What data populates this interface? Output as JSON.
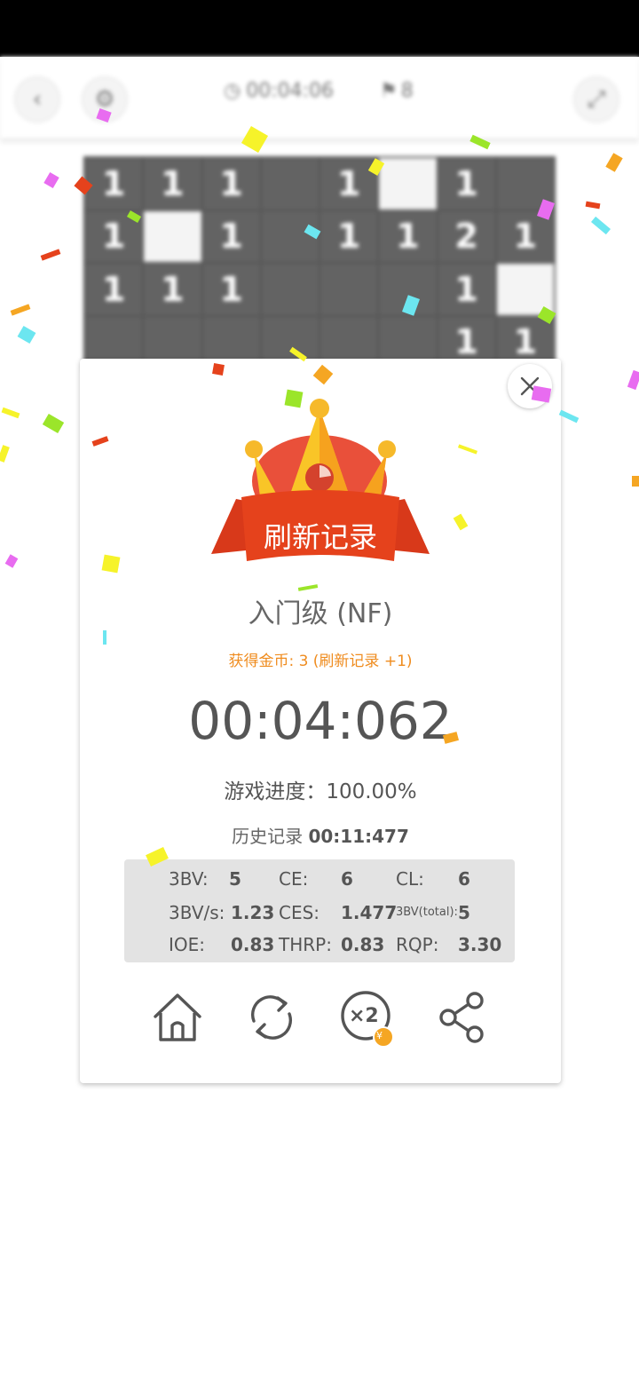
{
  "game": {
    "timer": "00:04:06",
    "flags": "8",
    "board_rows": [
      [
        "1",
        "1",
        "1",
        "",
        "1",
        "open",
        "1",
        ""
      ],
      [
        "1",
        "open",
        "1",
        "",
        "1",
        "1",
        "2",
        "1"
      ],
      [
        "1",
        "1",
        "1",
        "",
        "",
        "",
        "1",
        "open"
      ],
      [
        "",
        "",
        "",
        "",
        "",
        "",
        "1",
        "1"
      ]
    ]
  },
  "dialog": {
    "banner": "刷新记录",
    "level": "入门级 (NF)",
    "coins": "获得金币: 3 (刷新记录 +1)",
    "time": "00:04:062",
    "progress": "游戏进度：100.00%",
    "history_label": "历史记录",
    "history_value": "00:11:477",
    "stats": {
      "bbbv_label": "3BV:",
      "bbbv": "5",
      "ce_label": "CE:",
      "ce": "6",
      "cl_label": "CL:",
      "cl": "6",
      "bbbvs_label": "3BV/s:",
      "bbbvs": "1.23",
      "ces_label": "CES:",
      "ces": "1.477",
      "bbbv_total_label": "3BV(total):",
      "bbbv_total": "5",
      "ioe_label": "IOE:",
      "ioe": "0.83",
      "thrp_label": "THRP:",
      "thrp": "0.83",
      "rqp_label": "RQP:",
      "rqp": "3.30"
    },
    "double_badge": "×2",
    "coin_glyph": "¥"
  },
  "colors": {
    "accent_orange": "#ef8c1f",
    "ribbon_red": "#e5421c",
    "crown_yellow": "#f9c527",
    "crown_orange": "#f6a21e",
    "icon_gray": "#555555"
  },
  "icons": [
    "back-icon",
    "settings-icon",
    "clock-icon",
    "flag-icon",
    "expand-icon",
    "close-icon",
    "home-icon",
    "restart-icon",
    "double-coins-icon",
    "share-icon"
  ]
}
